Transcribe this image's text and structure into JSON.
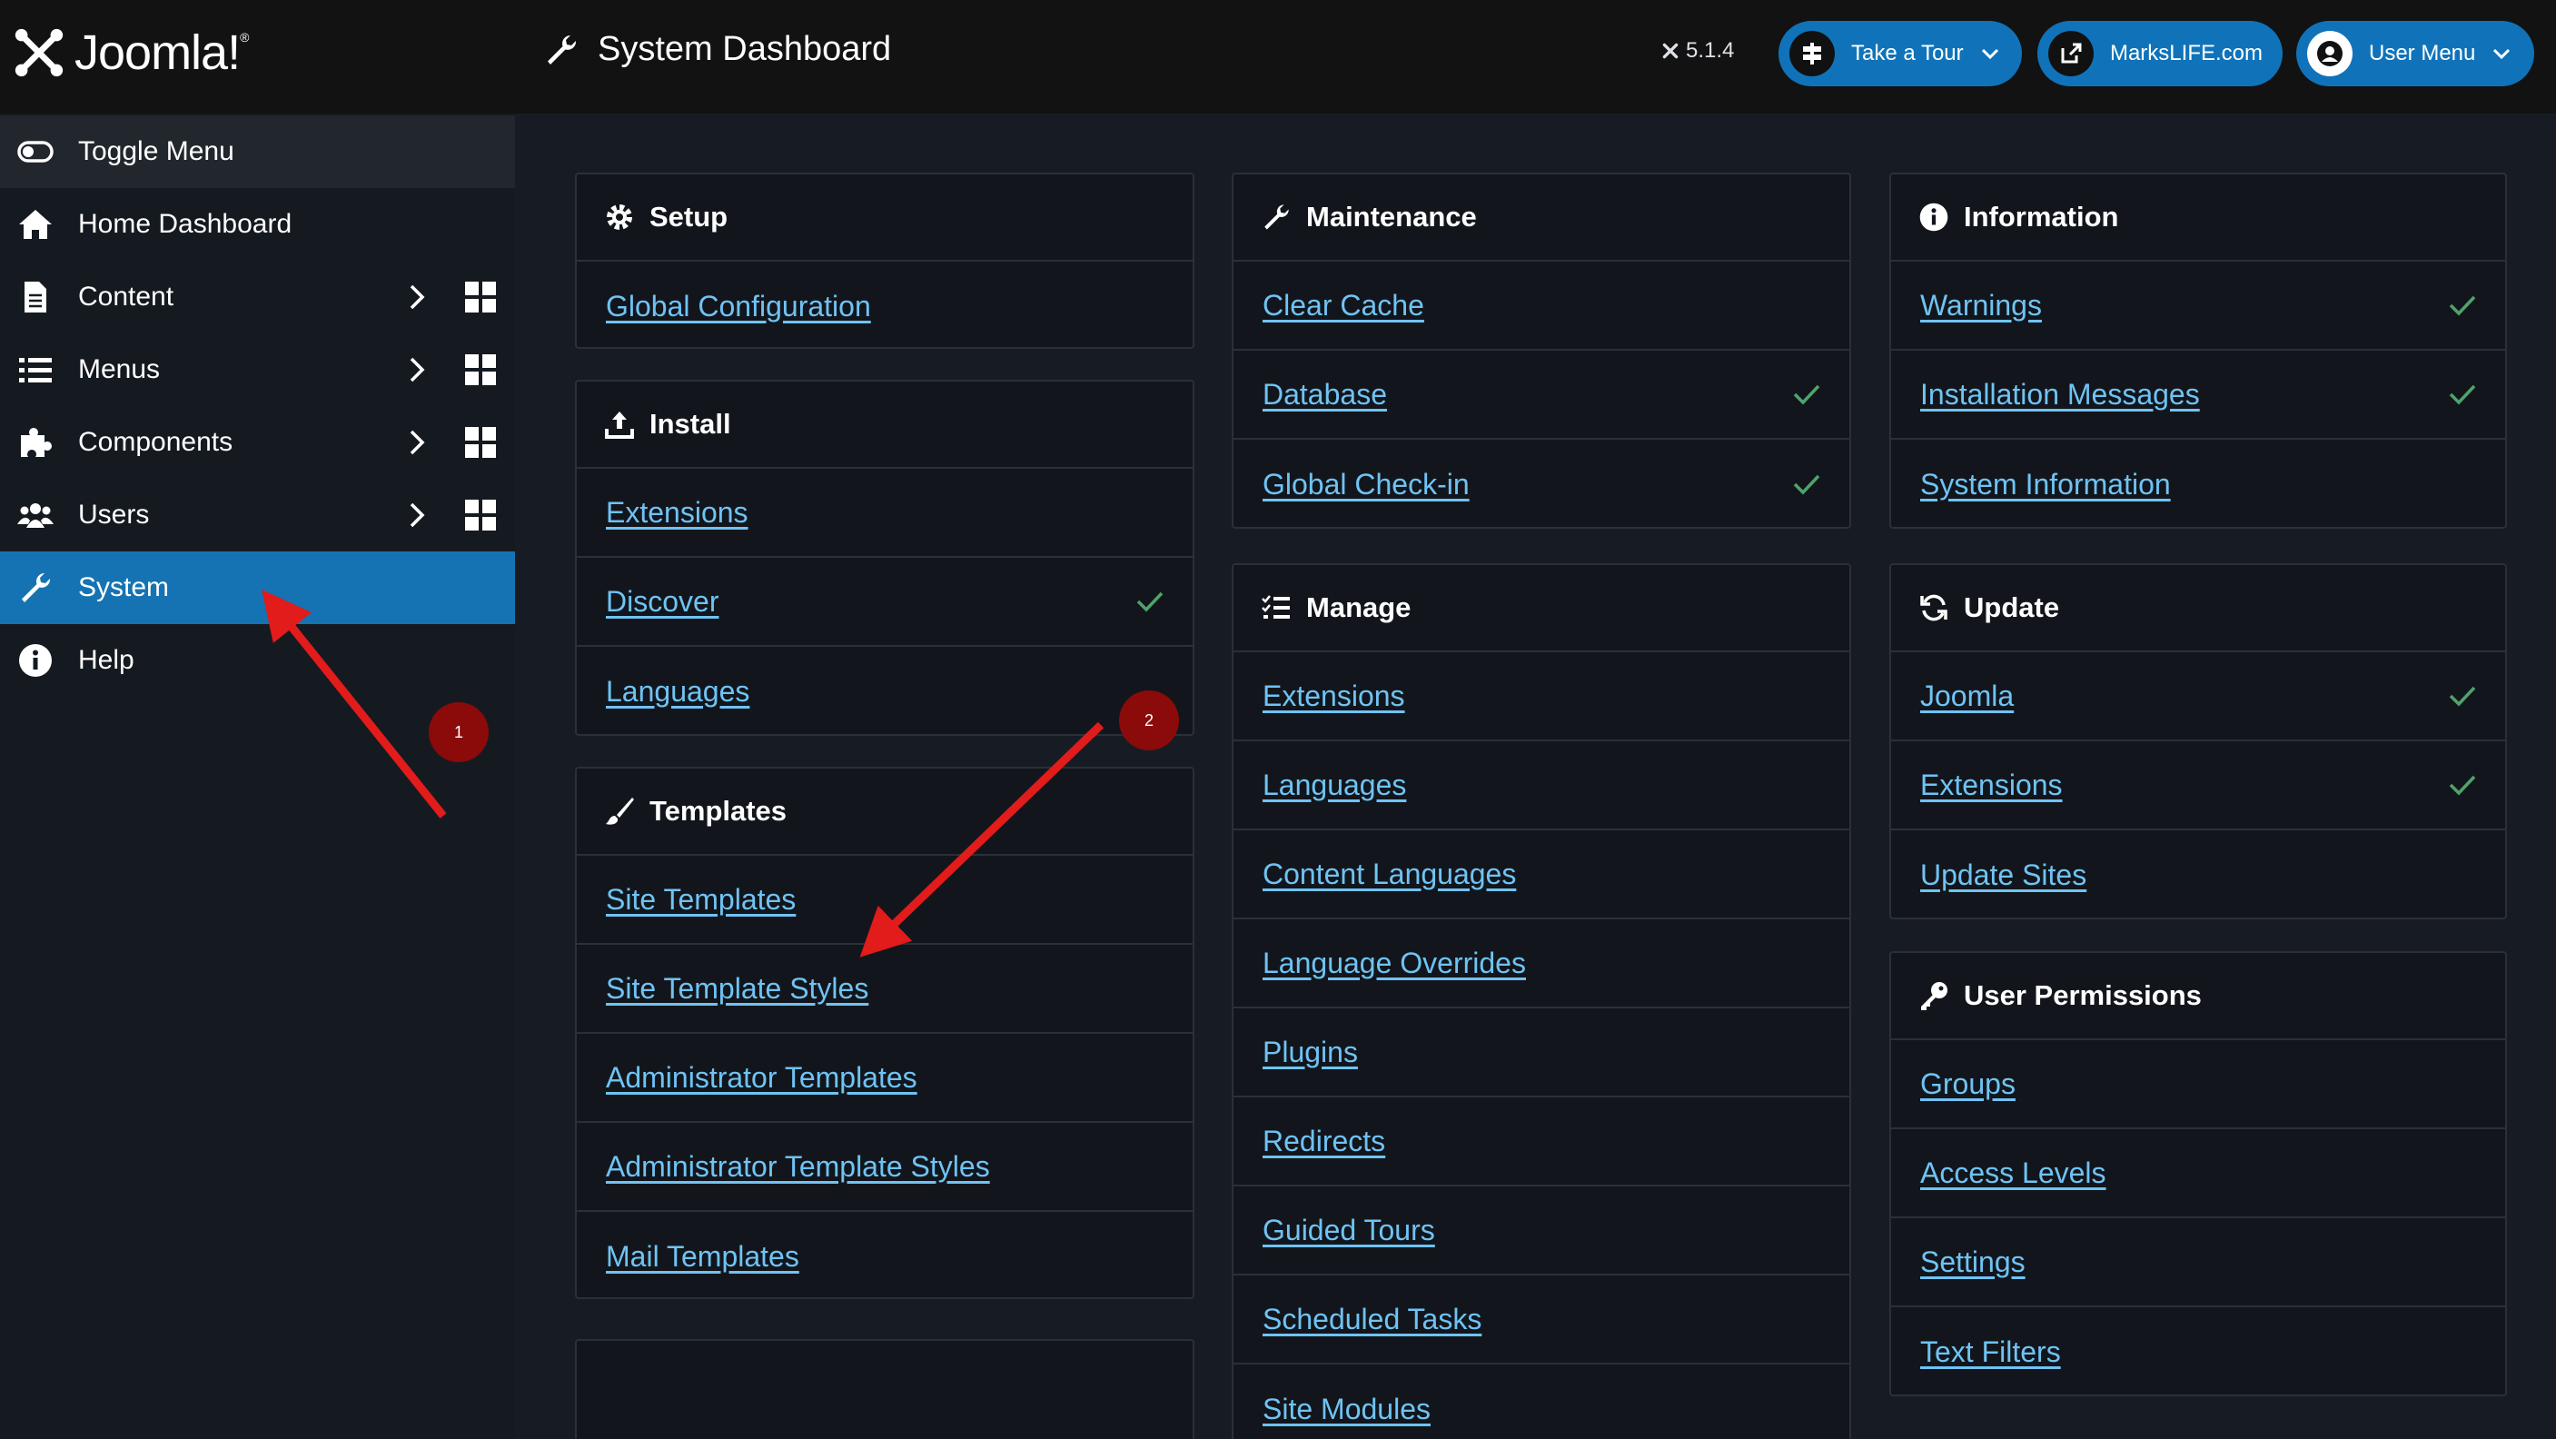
{
  "header": {
    "brand": "Joomla!",
    "title": "System Dashboard",
    "version": "5.1.4",
    "tour_label": "Take a Tour",
    "site_label": "MarksLIFE.com",
    "user_label": "User Menu"
  },
  "sidebar": {
    "items": [
      {
        "label": "Toggle Menu",
        "icon": "toggle-icon"
      },
      {
        "label": "Home Dashboard",
        "icon": "home-icon"
      },
      {
        "label": "Content",
        "icon": "file-icon"
      },
      {
        "label": "Menus",
        "icon": "list-icon"
      },
      {
        "label": "Components",
        "icon": "puzzle-icon"
      },
      {
        "label": "Users",
        "icon": "users-icon"
      },
      {
        "label": "System",
        "icon": "wrench-icon"
      },
      {
        "label": "Help",
        "icon": "info-icon"
      }
    ]
  },
  "cards": {
    "setup": {
      "title": "Setup",
      "links": [
        "Global Configuration"
      ]
    },
    "install": {
      "title": "Install",
      "links": [
        "Extensions",
        "Discover",
        "Languages"
      ]
    },
    "templates": {
      "title": "Templates",
      "links": [
        "Site Templates",
        "Site Template Styles",
        "Administrator Templates",
        "Administrator Template Styles",
        "Mail Templates"
      ]
    },
    "maintenance": {
      "title": "Maintenance",
      "links": [
        "Clear Cache",
        "Database",
        "Global Check-in"
      ]
    },
    "manage": {
      "title": "Manage",
      "links": [
        "Extensions",
        "Languages",
        "Content Languages",
        "Language Overrides",
        "Plugins",
        "Redirects",
        "Guided Tours",
        "Scheduled Tasks",
        "Site Modules"
      ]
    },
    "information": {
      "title": "Information",
      "links": [
        "Warnings",
        "Installation Messages",
        "System Information"
      ]
    },
    "update": {
      "title": "Update",
      "links": [
        "Joomla",
        "Extensions",
        "Update Sites"
      ]
    },
    "permissions": {
      "title": "User Permissions",
      "links": [
        "Groups",
        "Access Levels",
        "Settings",
        "Text Filters"
      ]
    }
  },
  "annotations": {
    "badge1": "1",
    "badge2": "2"
  },
  "colors": {
    "accent": "#1573b3",
    "link": "#6fc3f4",
    "check": "#4fa36b",
    "annotation": "#e21b1b"
  }
}
